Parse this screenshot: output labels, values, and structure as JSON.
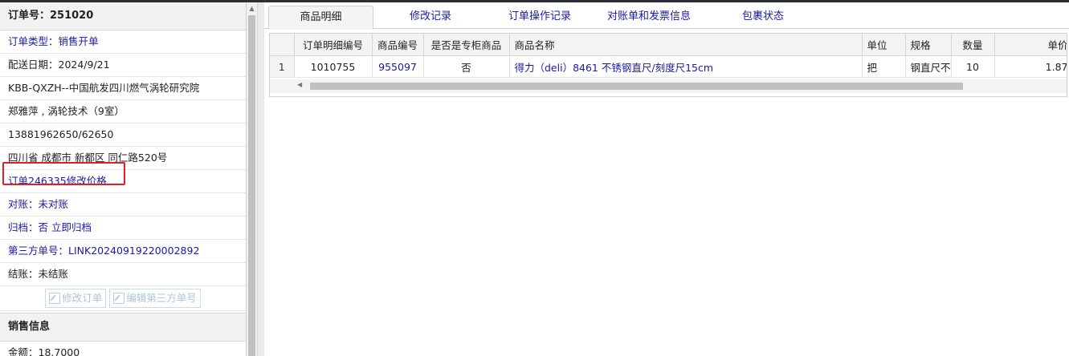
{
  "order": {
    "title": "订单号：251020",
    "rows": [
      {
        "text": "订单类型：销售开单",
        "blue": true
      },
      {
        "text": "配送日期：2024/9/21",
        "blue": false
      },
      {
        "text": "KBB-QXZH--中国航发四川燃气涡轮研究院",
        "blue": false
      },
      {
        "text": "郑雅萍 , 涡轮技术（9室）",
        "blue": false
      },
      {
        "text": "13881962650/62650",
        "blue": false
      },
      {
        "text": "四川省 成都市 新都区 同仁路520号",
        "blue": false
      },
      {
        "text": "订单246335修改价格",
        "blue": true
      },
      {
        "text": "对账：未对账",
        "blue": true
      },
      {
        "text": "归档：否 立即归档",
        "blue": true
      },
      {
        "text": "第三方单号：LINK20240919220002892",
        "blue": true
      },
      {
        "text": "结账：未结账",
        "blue": false
      }
    ],
    "buttons": {
      "edit_order": "修改订单",
      "edit_third_party": "编辑第三方单号"
    }
  },
  "sales": {
    "title": "销售信息",
    "amount": "金额：18.7000"
  },
  "tabs": [
    {
      "label": "商品明细",
      "active": true
    },
    {
      "label": "修改记录",
      "active": false
    },
    {
      "label": "订单操作记录",
      "active": false
    },
    {
      "label": "对账单和发票信息",
      "active": false
    },
    {
      "label": "包裹状态",
      "active": false
    }
  ],
  "table": {
    "columns": [
      "订单明细编号",
      "商品编号",
      "是否是专柜商品",
      "商品名称",
      "单位",
      "规格",
      "数量",
      "单价"
    ],
    "rows": [
      {
        "index": "1",
        "detail_id": "1010755",
        "product_id": "955097",
        "is_counter": "否",
        "name": "得力（deli）8461 不锈钢直尺/刻度尺15cm",
        "unit": "把",
        "spec": "钢直尺不",
        "qty": "10",
        "price": "1.87"
      }
    ]
  },
  "colors": {
    "link": "#1a1aa6",
    "highlight": "#e02020"
  }
}
